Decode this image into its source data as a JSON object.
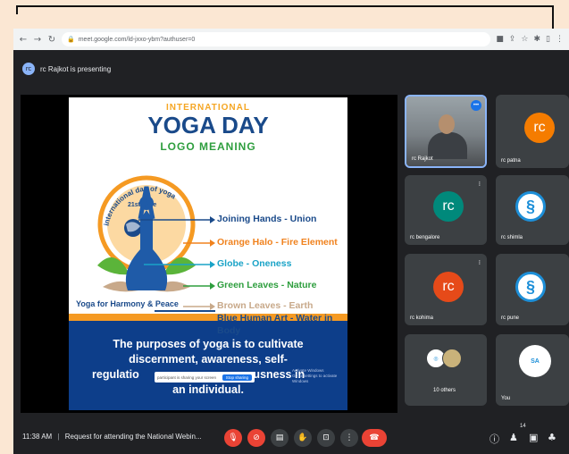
{
  "browser": {
    "back_icon": "arrow-left-icon",
    "url": "meet.google.com/ld-jxxo-ybm?authuser=0"
  },
  "presenting": {
    "avatar_initials": "rc",
    "text": "rc Rajkot is presenting"
  },
  "slide": {
    "line1": "INTERNATIONAL",
    "line2": "YOGA DAY",
    "line3": "LOGO MEANING",
    "arc_text": "international day of yoga",
    "date": "21st June",
    "labels": [
      {
        "text": "Joining Hands - Union",
        "color": "#1a4a8a"
      },
      {
        "text": "Orange Halo - Fire Element",
        "color": "#f0821e"
      },
      {
        "text": "Globe - Oneness",
        "color": "#1aa3c7"
      },
      {
        "text": "Green Leaves - Nature",
        "color": "#2e9e3e"
      },
      {
        "text": "Brown Leaves - Earth",
        "color": "#c8a98a"
      },
      {
        "text": "Blue Human Art - Water in Body",
        "color": "#1a4a8a"
      }
    ],
    "tagline": "Yoga for Harmony & Peace",
    "purpose_line1": "The purposes of yoga is to cultivate",
    "purpose_line2": "discernment, awareness, self-",
    "purpose_line3a": "regulatio",
    "purpose_line3b": "ousness in",
    "purpose_line4": "an individual.",
    "caption_text": "participant is sharing your screen",
    "caption_button": "Stop sharing",
    "side_note1": "Activate Windows",
    "side_note2": "Go to Settings to activate Windows"
  },
  "participants": [
    {
      "name": "rc Rajkot",
      "type": "video"
    },
    {
      "name": "rc patna",
      "initials": "rc",
      "color": "#f57c00"
    },
    {
      "name": "rc bengalore",
      "initials": "rc",
      "color": "#00897b"
    },
    {
      "name": "rc shimla",
      "type": "logo"
    },
    {
      "name": "rc kohima",
      "initials": "rc",
      "color": "#e64a19"
    },
    {
      "name": "rc pune",
      "type": "logo"
    },
    {
      "name": "10 others",
      "type": "others"
    },
    {
      "name": "You",
      "type": "self",
      "logo_text": "SA"
    }
  ],
  "toolbar": {
    "time": "11:38 AM",
    "separator": "|",
    "meeting_title": "Request for attending the National Webin...",
    "participant_count": "14"
  },
  "colors": {
    "accent": "#1a73e8",
    "danger": "#ea4335",
    "background": "#202124"
  }
}
